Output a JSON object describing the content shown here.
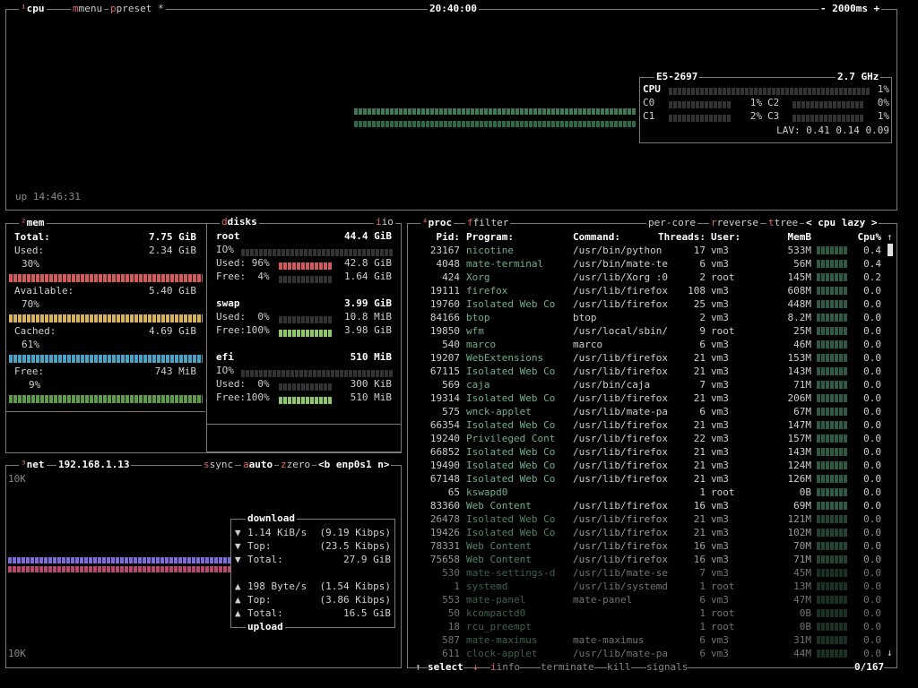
{
  "cpu": {
    "title": "cpu",
    "menu": "menu",
    "preset": "preset *",
    "clock": "20:40:00",
    "refresh": "- 2000ms +",
    "uptime": "up 14:46:31",
    "model": "E5-2697",
    "freq": "2.7 GHz",
    "total_label": "CPU",
    "total_pct": "1%",
    "cores": [
      {
        "label": "C0",
        "pct": "1%"
      },
      {
        "label": "C1",
        "pct": "2%"
      },
      {
        "label": "C2",
        "pct": "0%"
      },
      {
        "label": "C3",
        "pct": "1%"
      }
    ],
    "lav": "LAV: 0.41 0.14 0.09"
  },
  "mem": {
    "title": "mem",
    "total_label": "Total:",
    "total": "7.75 GiB",
    "used_label": "Used:",
    "used": "2.34 GiB",
    "used_pct": "30%",
    "available_label": "Available:",
    "available": "5.40 GiB",
    "available_pct": "70%",
    "cached_label": "Cached:",
    "cached": "4.69 GiB",
    "cached_pct": "61%",
    "free_label": "Free:",
    "free": "743 MiB",
    "free_pct": "9%"
  },
  "disks": {
    "title": "disks",
    "io_label": "io",
    "items": [
      {
        "name": "root",
        "size": "44.4 GiB",
        "io": "IO%",
        "used_label": "Used: 96%",
        "used": "42.8 GiB",
        "free_label": "Free:  4%",
        "free": "1.64 GiB"
      },
      {
        "name": "swap",
        "size": "3.99 GiB",
        "used_label": "Used:  0%",
        "used": "10.8 MiB",
        "free_label": "Free:100%",
        "free": "3.98 GiB"
      },
      {
        "name": "efi",
        "size": "510 MiB",
        "io": "IO%",
        "used_label": "Used:  0%",
        "used": "300 KiB",
        "free_label": "Free:100%",
        "free": "510 MiB"
      }
    ]
  },
  "net": {
    "title": "net",
    "ip": "192.168.1.13",
    "sync": "sync",
    "auto": "auto",
    "zero": "zero",
    "iface": "<b enp0s1 n>",
    "scale_top": "10K",
    "scale_bottom": "10K",
    "download_label": "download",
    "upload_label": "upload",
    "down_rate": "1.14 KiB/s",
    "down_rate_bits": "(9.19 Kibps)",
    "down_top_label": "Top:",
    "down_top": "(23.5 Kibps)",
    "down_total_label": "Total:",
    "down_total": "27.9 GiB",
    "up_rate": "198 Byte/s",
    "up_rate_bits": "(1.54 Kibps)",
    "up_top_label": "Top:",
    "up_top": "(3.86 Kibps)",
    "up_total_label": "Total:",
    "up_total": "16.5 GiB"
  },
  "proc": {
    "title": "proc",
    "filter": "filter",
    "per_core": "per-core",
    "reverse": "reverse",
    "tree": "tree",
    "sort": "< cpu lazy >",
    "columns": {
      "pid": "Pid:",
      "program": "Program:",
      "command": "Command:",
      "threads": "Threads:",
      "user": "User:",
      "memb": "MemB",
      "cpu": "Cpu%"
    },
    "rows": [
      [
        "23167",
        "nicotine",
        "/usr/bin/python",
        "17",
        "vm3",
        "533M",
        "0.4"
      ],
      [
        "4048",
        "mate-terminal",
        "/usr/bin/mate-te",
        "6",
        "vm3",
        "56M",
        "0.4"
      ],
      [
        "424",
        "Xorg",
        "/usr/lib/Xorg :0",
        "2",
        "root",
        "145M",
        "0.2"
      ],
      [
        "19111",
        "firefox",
        "/usr/lib/firefox",
        "108",
        "vm3",
        "608M",
        "0.0"
      ],
      [
        "19760",
        "Isolated Web Co",
        "/usr/lib/firefox",
        "25",
        "vm3",
        "448M",
        "0.0"
      ],
      [
        "84166",
        "btop",
        "btop",
        "2",
        "vm3",
        "8.2M",
        "0.0"
      ],
      [
        "19850",
        "wfm",
        "/usr/local/sbin/",
        "9",
        "root",
        "25M",
        "0.0"
      ],
      [
        "540",
        "marco",
        "marco",
        "6",
        "vm3",
        "46M",
        "0.0"
      ],
      [
        "19207",
        "WebExtensions",
        "/usr/lib/firefox",
        "21",
        "vm3",
        "153M",
        "0.0"
      ],
      [
        "67115",
        "Isolated Web Co",
        "/usr/lib/firefox",
        "21",
        "vm3",
        "143M",
        "0.0"
      ],
      [
        "569",
        "caja",
        "/usr/bin/caja",
        "7",
        "vm3",
        "71M",
        "0.0"
      ],
      [
        "19314",
        "Isolated Web Co",
        "/usr/lib/firefox",
        "21",
        "vm3",
        "206M",
        "0.0"
      ],
      [
        "575",
        "wnck-applet",
        "/usr/lib/mate-pa",
        "6",
        "vm3",
        "67M",
        "0.0"
      ],
      [
        "66354",
        "Isolated Web Co",
        "/usr/lib/firefox",
        "21",
        "vm3",
        "147M",
        "0.0"
      ],
      [
        "19240",
        "Privileged Cont",
        "/usr/lib/firefox",
        "22",
        "vm3",
        "157M",
        "0.0"
      ],
      [
        "66852",
        "Isolated Web Co",
        "/usr/lib/firefox",
        "21",
        "vm3",
        "143M",
        "0.0"
      ],
      [
        "19490",
        "Isolated Web Co",
        "/usr/lib/firefox",
        "21",
        "vm3",
        "124M",
        "0.0"
      ],
      [
        "67148",
        "Isolated Web Co",
        "/usr/lib/firefox",
        "21",
        "vm3",
        "126M",
        "0.0"
      ],
      [
        "65",
        "kswapd0",
        "",
        "1",
        "root",
        "0B",
        "0.0"
      ],
      [
        "83360",
        "Web Content",
        "/usr/lib/firefox",
        "16",
        "vm3",
        "69M",
        "0.0"
      ],
      [
        "26478",
        "Isolated Web Co",
        "/usr/lib/firefox",
        "21",
        "vm3",
        "121M",
        "0.0"
      ],
      [
        "19426",
        "Isolated Web Co",
        "/usr/lib/firefox",
        "21",
        "vm3",
        "102M",
        "0.0"
      ],
      [
        "78331",
        "Web Content",
        "/usr/lib/firefox",
        "16",
        "vm3",
        "70M",
        "0.0"
      ],
      [
        "75658",
        "Web Content",
        "/usr/lib/firefox",
        "16",
        "vm3",
        "71M",
        "0.0"
      ],
      [
        "530",
        "mate-settings-d",
        "/usr/lib/mate-se",
        "7",
        "vm3",
        "45M",
        "0.0"
      ],
      [
        "1",
        "systemd",
        "/usr/lib/systemd",
        "1",
        "root",
        "13M",
        "0.0"
      ],
      [
        "553",
        "mate-panel",
        "mate-panel",
        "6",
        "vm3",
        "47M",
        "0.0"
      ],
      [
        "50",
        "kcompactd0",
        "",
        "1",
        "root",
        "0B",
        "0.0"
      ],
      [
        "18",
        "rcu_preempt",
        "",
        "1",
        "root",
        "0B",
        "0.0"
      ],
      [
        "587",
        "mate-maximus",
        "mate-maximus",
        "6",
        "vm3",
        "31M",
        "0.0"
      ],
      [
        "611",
        "clock-applet",
        "/usr/lib/mate-pa",
        "6",
        "vm3",
        "44M",
        "0.0"
      ]
    ],
    "footer_select": "select",
    "footer_info": "info",
    "footer_terminate": "terminate",
    "footer_kill": "kill",
    "footer_signals": "signals",
    "count": "0/167"
  },
  "colors": {
    "border": "#7a7a7a",
    "hotkey": "#e06868",
    "used": "#d25a5a",
    "available": "#d6b25a",
    "cached": "#4aa3c7",
    "free": "#8fc86a",
    "download": "#7e6ad8",
    "upload": "#b8486e"
  }
}
